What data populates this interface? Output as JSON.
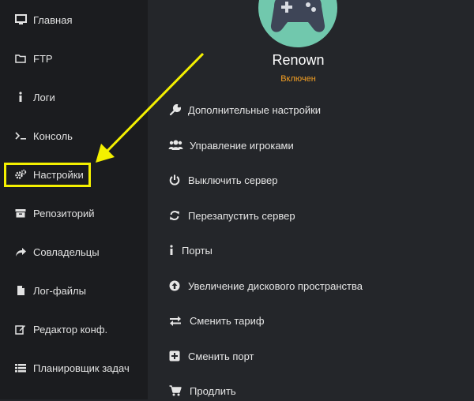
{
  "sidebar": {
    "items": [
      {
        "label": "Главная",
        "icon": "monitor-icon"
      },
      {
        "label": "FTP",
        "icon": "folder-icon"
      },
      {
        "label": "Логи",
        "icon": "info-icon"
      },
      {
        "label": "Консоль",
        "icon": "terminal-icon"
      },
      {
        "label": "Настройки",
        "icon": "gears-icon"
      },
      {
        "label": "Репозиторий",
        "icon": "archive-icon"
      },
      {
        "label": "Совладельцы",
        "icon": "share-icon"
      },
      {
        "label": "Лог-файлы",
        "icon": "file-icon"
      },
      {
        "label": "Редактор конф.",
        "icon": "edit-icon"
      },
      {
        "label": "Планировщик задач",
        "icon": "list-icon"
      }
    ]
  },
  "server": {
    "name": "Renown",
    "status": "Включен",
    "avatar_icon": "gamepad-icon"
  },
  "menu": {
    "items": [
      {
        "label": "Дополнительные настройки",
        "icon": "wrench-icon"
      },
      {
        "label": "Управление игроками",
        "icon": "users-icon"
      },
      {
        "label": "Выключить сервер",
        "icon": "power-icon"
      },
      {
        "label": "Перезапустить сервер",
        "icon": "refresh-icon"
      },
      {
        "label": "Порты",
        "icon": "info-icon"
      },
      {
        "label": "Увеличение дискового пространства",
        "icon": "arrow-up-circle-icon"
      },
      {
        "label": "Сменить тариф",
        "icon": "exchange-icon"
      },
      {
        "label": "Сменить порт",
        "icon": "plus-square-icon"
      },
      {
        "label": "Продлить",
        "icon": "cart-icon"
      }
    ]
  },
  "colors": {
    "sidebar_bg": "#1b1c1f",
    "main_bg": "#24262a",
    "avatar_bg": "#71c8ad",
    "status": "#f5a023",
    "highlight": "#f4f000"
  }
}
